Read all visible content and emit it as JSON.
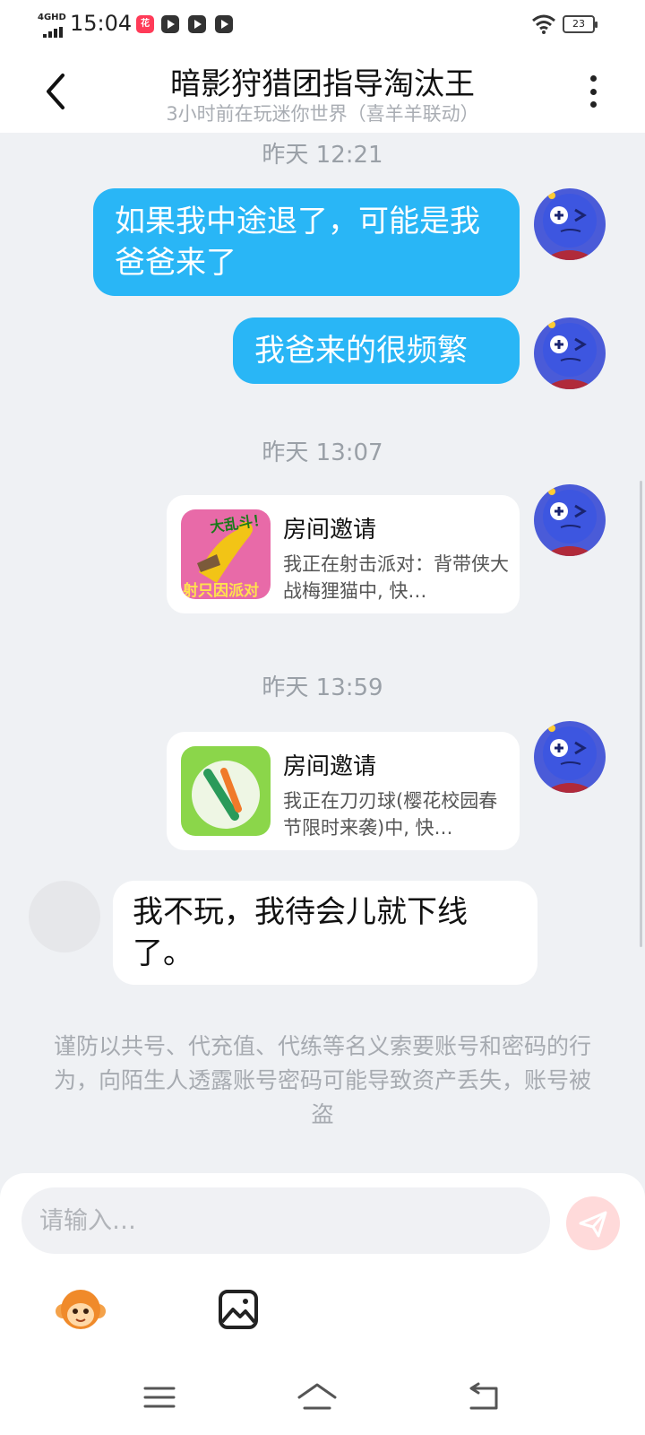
{
  "status_bar": {
    "network": "4GHD",
    "time": "15:04",
    "app_badge": "花",
    "battery": "23"
  },
  "header": {
    "title": "暗影狩猎团指导淘汰王",
    "subtitle": "3小时前在玩迷你世界（喜羊羊联动）"
  },
  "messages": {
    "ts1": "昨天 12:21",
    "out1": "如果我中途退了，可能是我爸爸来了",
    "out2": "我爸来的很频繁",
    "ts2": "昨天 13:07",
    "card1": {
      "title": "房间邀请",
      "desc": "我正在射击派对：背带侠大战梅狸猫中, 快…",
      "thumb_top": "大乱斗！",
      "thumb_bottom": "射只因派对"
    },
    "ts3": "昨天 13:59",
    "card2": {
      "title": "房间邀请",
      "desc": "我正在刀刃球(樱花校园春节限时来袭)中, 快…"
    },
    "in1": "我不玩，我待会儿就下线了。"
  },
  "notice": "谨防以共号、代充值、代练等名义索要账号和密码的行为，向陌生人透露账号密码可能导致资产丢失，账号被盗",
  "input": {
    "placeholder": "请输入…"
  },
  "icons": {
    "back": "back-arrow-icon",
    "more": "more-vertical-icon",
    "send": "send-icon",
    "emoji": "monkey-emoji-icon",
    "image": "image-icon",
    "nav_menu": "menu-icon",
    "nav_home": "home-icon",
    "nav_back": "return-icon"
  },
  "colors": {
    "outgoing_bubble": "#29b6f6",
    "background": "#eff1f4",
    "send_button": "#ffdada"
  }
}
